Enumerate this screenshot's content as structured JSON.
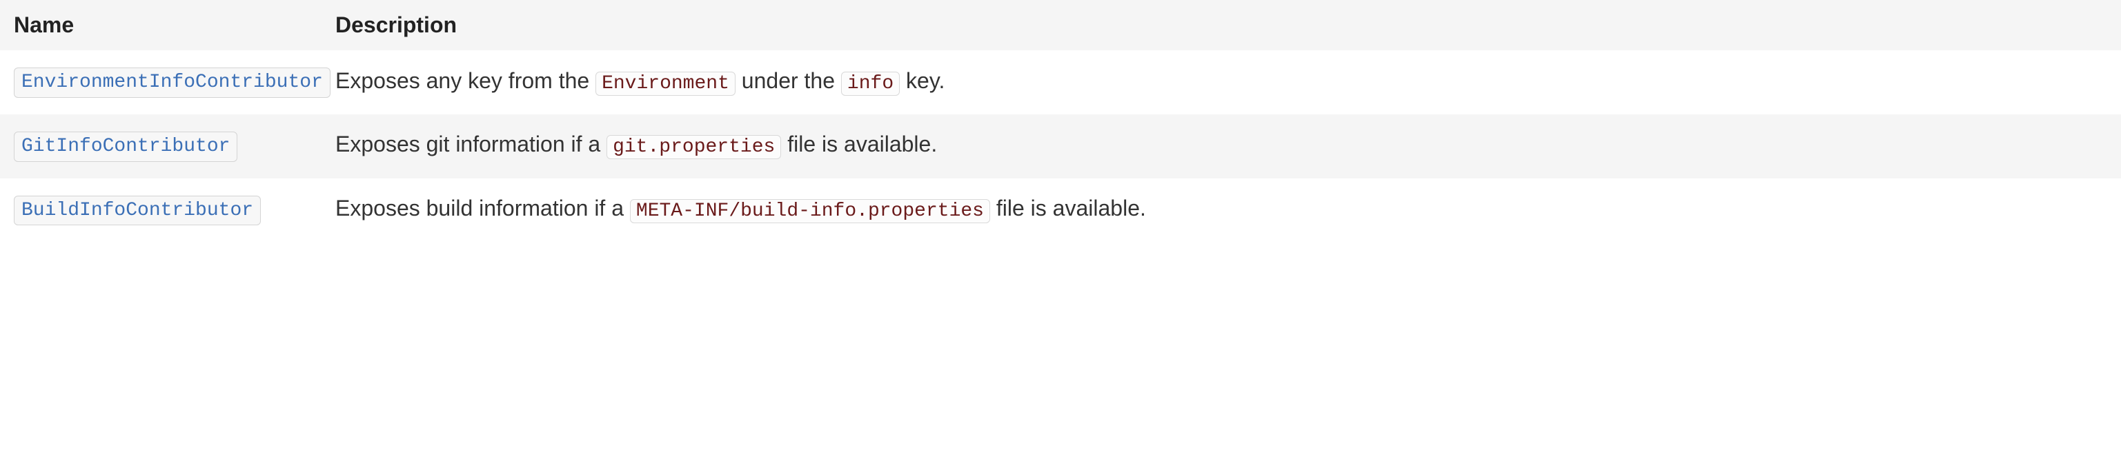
{
  "table": {
    "headers": {
      "name": "Name",
      "description": "Description"
    },
    "rows": [
      {
        "link": "EnvironmentInfoContributor",
        "desc_pre": "Exposes any key from the ",
        "code1": "Environment",
        "desc_mid": " under the ",
        "code2": "info",
        "desc_post": " key."
      },
      {
        "link": "GitInfoContributor",
        "desc_pre": "Exposes git information if a ",
        "code1": "git.properties",
        "desc_mid": "",
        "code2": "",
        "desc_post": " file is available."
      },
      {
        "link": "BuildInfoContributor",
        "desc_pre": "Exposes build information if a ",
        "code1": "META-INF/build-info.properties",
        "desc_mid": "",
        "code2": "",
        "desc_post": " file is available."
      }
    ]
  }
}
